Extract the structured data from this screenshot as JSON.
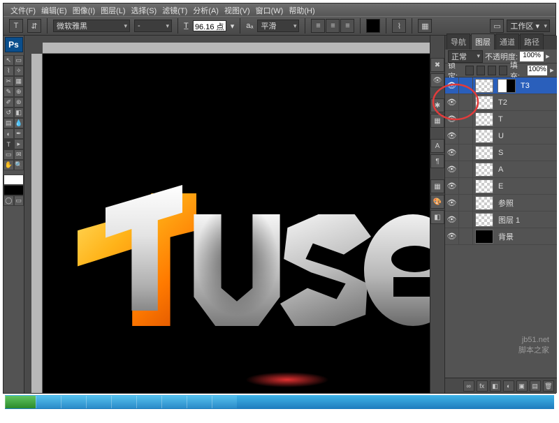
{
  "menu": {
    "file": "文件(F)",
    "edit": "编辑(E)",
    "image": "图像(I)",
    "layer": "图层(L)",
    "select": "选择(S)",
    "filter": "滤镜(T)",
    "analysis": "分析(A)",
    "view": "视图(V)",
    "window": "窗口(W)",
    "help": "帮助(H)"
  },
  "optbar": {
    "tool_glyph": "T",
    "orient": "⇵",
    "font_family": "微软雅黑",
    "font_style": "-",
    "size_value": "96.16 点",
    "aa_label": "aₐ",
    "aa_mode": "平滑",
    "color_swatch": "#000000"
  },
  "workspace": {
    "label": "工作区 ▾"
  },
  "canvas": {
    "visible_text": "tusea"
  },
  "panel": {
    "tabs": {
      "nav": "导航",
      "layers": "图层",
      "channels": "通道",
      "paths": "路径"
    },
    "blend_mode": "正常",
    "opacity_label": "不透明度:",
    "opacity": "100%",
    "lock_label": "锁定:",
    "fill_label": "填充:",
    "fill": "100%",
    "layers": [
      {
        "name": "T3",
        "sel": true,
        "mask": true
      },
      {
        "name": "T2"
      },
      {
        "name": "T"
      },
      {
        "name": "U"
      },
      {
        "name": "S"
      },
      {
        "name": "A"
      },
      {
        "name": "E"
      },
      {
        "name": "参照"
      },
      {
        "name": "图层 1"
      },
      {
        "name": "背景",
        "bg": true
      }
    ]
  },
  "watermark": {
    "line1": "jb51.net",
    "line2": "脚本之家"
  },
  "ps_logo": "Ps"
}
